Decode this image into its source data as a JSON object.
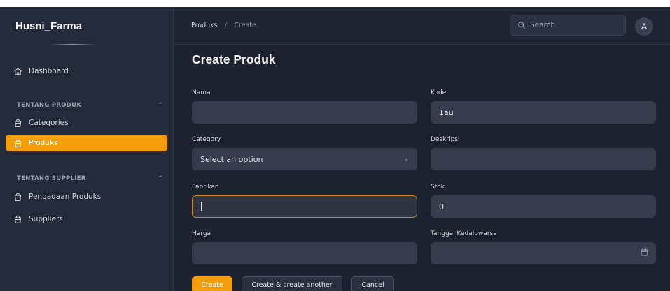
{
  "brand": "Husni_Farma",
  "sidebar": {
    "dashboard": "Dashboard",
    "group1": {
      "title": "TENTANG PRODUK",
      "items": [
        "Categories",
        "Produks"
      ]
    },
    "group2": {
      "title": "TENTANG SUPPLIER",
      "items": [
        "Pengadaan Produks",
        "Suppliers"
      ]
    },
    "active_item": "Produks"
  },
  "topbar": {
    "breadcrumb": [
      "Produks",
      "Create"
    ],
    "search_placeholder": "Search",
    "avatar_initial": "A"
  },
  "page": {
    "title": "Create Produk"
  },
  "form": {
    "nama": {
      "label": "Nama",
      "value": ""
    },
    "kode": {
      "label": "Kode",
      "value": "1au"
    },
    "category": {
      "label": "Category",
      "value": "Select an option"
    },
    "deskripsi": {
      "label": "Deskripsi",
      "value": ""
    },
    "pabrikan": {
      "label": "Pabrikan",
      "value": ""
    },
    "stok": {
      "label": "Stok",
      "value": "0"
    },
    "harga": {
      "label": "Harga",
      "value": ""
    },
    "kedaluwarsa": {
      "label": "Tanggal Kedaluwarsa",
      "value": ""
    }
  },
  "actions": {
    "create": "Create",
    "create_another": "Create & create another",
    "cancel": "Cancel"
  },
  "colors": {
    "accent": "#f59e0b",
    "background": "#1c2230",
    "sidebar": "#232a39",
    "input": "#363c4c"
  }
}
